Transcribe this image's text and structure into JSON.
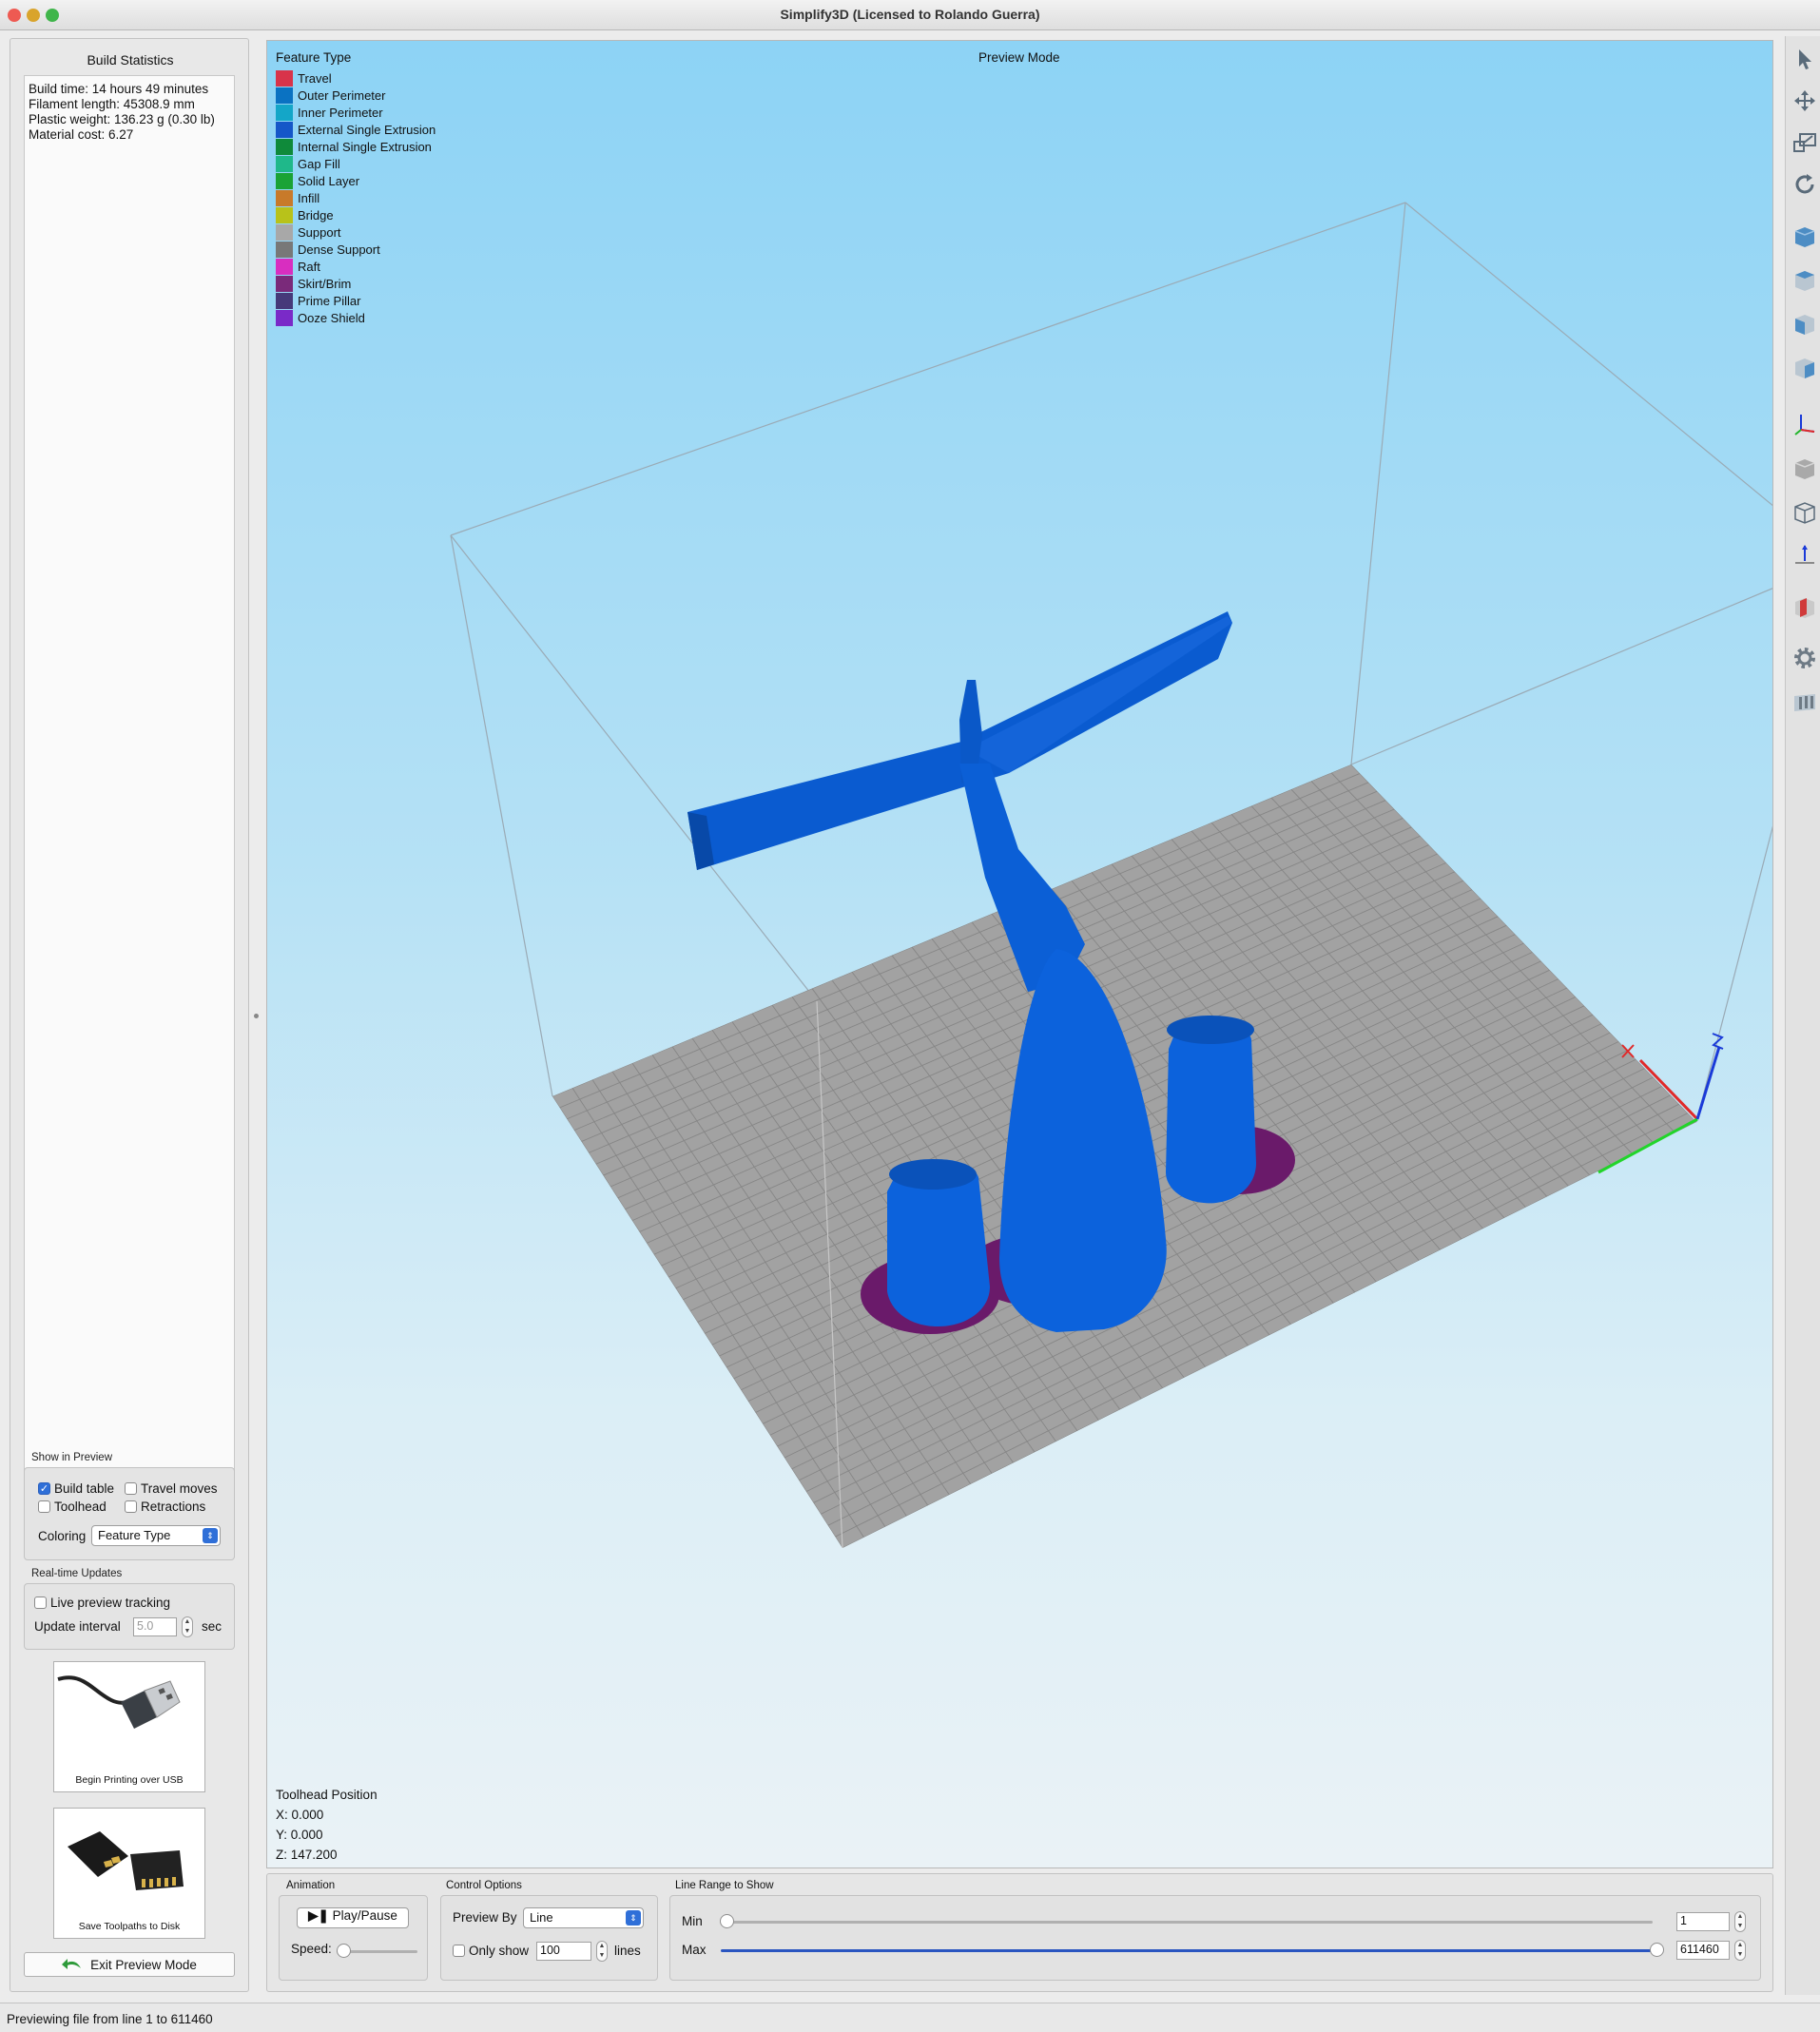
{
  "window": {
    "title": "Simplify3D (Licensed to Rolando Guerra)"
  },
  "build_statistics": {
    "header": "Build Statistics",
    "lines": [
      "Build time: 14 hours 49 minutes",
      "Filament length: 45308.9 mm",
      "Plastic weight: 136.23 g (0.30 lb)",
      "Material cost: 6.27"
    ]
  },
  "show_in_preview": {
    "label": "Show in Preview",
    "build_table": {
      "label": "Build table",
      "checked": true
    },
    "travel_moves": {
      "label": "Travel moves",
      "checked": false
    },
    "toolhead": {
      "label": "Toolhead",
      "checked": false
    },
    "retractions": {
      "label": "Retractions",
      "checked": false
    },
    "coloring_label": "Coloring",
    "coloring_value": "Feature Type"
  },
  "realtime": {
    "label": "Real-time Updates",
    "live_tracking": {
      "label": "Live preview tracking",
      "checked": false
    },
    "interval_label": "Update interval",
    "interval_value": "5.0",
    "interval_unit": "sec"
  },
  "actions": {
    "usb_label": "Begin Printing over USB",
    "disk_label": "Save Toolpaths to Disk",
    "exit_label": "Exit Preview Mode"
  },
  "viewport": {
    "legend_title": "Feature Type",
    "mode_label": "Preview Mode",
    "legend": [
      {
        "label": "Travel",
        "color": "#d8334a"
      },
      {
        "label": "Outer Perimeter",
        "color": "#0a72c2"
      },
      {
        "label": "Inner Perimeter",
        "color": "#14a6c8"
      },
      {
        "label": "External Single Extrusion",
        "color": "#1557c8"
      },
      {
        "label": "Internal Single Extrusion",
        "color": "#0f8a3a"
      },
      {
        "label": "Gap Fill",
        "color": "#1fb88a"
      },
      {
        "label": "Solid Layer",
        "color": "#1aa335"
      },
      {
        "label": "Infill",
        "color": "#c87a2a"
      },
      {
        "label": "Bridge",
        "color": "#b8c21a"
      },
      {
        "label": "Support",
        "color": "#a8a8a8"
      },
      {
        "label": "Dense Support",
        "color": "#787878"
      },
      {
        "label": "Raft",
        "color": "#d82ec0"
      },
      {
        "label": "Skirt/Brim",
        "color": "#7a2a7a"
      },
      {
        "label": "Prime Pillar",
        "color": "#463a7a"
      },
      {
        "label": "Ooze Shield",
        "color": "#7a2ac8"
      }
    ],
    "toolhead_title": "Toolhead Position",
    "toolhead_x": "X: 0.000",
    "toolhead_y": "Y: 0.000",
    "toolhead_z": "Z: 147.200",
    "model_color": "#0b5fd6",
    "brim_color": "#6a1a6a",
    "bed_color": "#a2a2a2"
  },
  "animation": {
    "label": "Animation",
    "play_label": "Play/Pause",
    "speed_label": "Speed:"
  },
  "control": {
    "label": "Control Options",
    "preview_by_label": "Preview By",
    "preview_by_value": "Line",
    "only_show": {
      "label": "Only show",
      "checked": false
    },
    "only_show_value": "100",
    "lines_label": "lines"
  },
  "line_range": {
    "label": "Line Range to Show",
    "min_label": "Min",
    "max_label": "Max",
    "min_value": "1",
    "max_value": "611460"
  },
  "status": "Previewing file from line 1 to 611460"
}
